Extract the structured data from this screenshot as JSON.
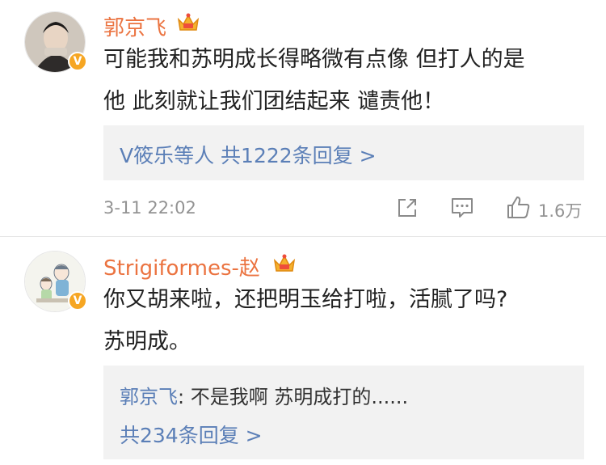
{
  "comments": [
    {
      "username": "郭京飞",
      "text_line1": "可能我和苏明成长得略微有点像  但打人的是",
      "text_line2": "他 此刻就让我们团结起来 谴责他！",
      "reply_summary": "V筱乐等人  共1222条回复 >",
      "timestamp": "3-11 22:02",
      "likes": "1.6万",
      "verified_badge": "V"
    },
    {
      "username": "Strigiformes-赵",
      "text_line1": "你又胡来啦，还把明玉给打啦，活腻了吗?",
      "text_line2": "苏明成。",
      "reply_author": "郭京飞",
      "reply_text": ": 不是我啊 苏明成打的......",
      "reply_count": "共234条回复 >",
      "verified_badge": "V"
    }
  ],
  "colors": {
    "username": "#eb7340",
    "link": "#5b7fb7",
    "meta": "#939393",
    "reply_bg": "#f2f2f2",
    "badge": "#f6a623"
  },
  "icons": [
    "crown-badge-icon",
    "share-icon",
    "comment-icon",
    "like-icon"
  ]
}
